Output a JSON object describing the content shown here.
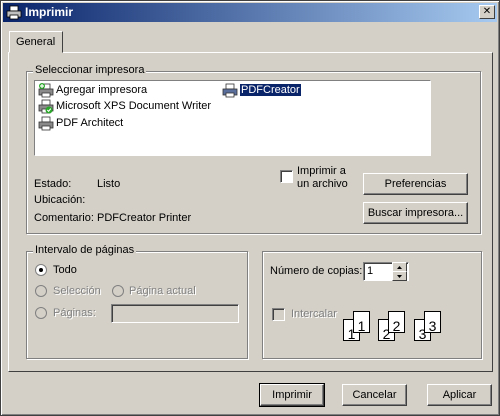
{
  "window": {
    "title": "Imprimir",
    "close_glyph": "✕"
  },
  "tabs": [
    {
      "label": "General",
      "active": true
    }
  ],
  "select_printer": {
    "legend": "Seleccionar impresora",
    "printers": [
      {
        "label": "Agregar impresora",
        "icon": "add-printer-icon",
        "selected": false
      },
      {
        "label": "Microsoft XPS Document Writer",
        "icon": "default-printer-icon",
        "selected": false
      },
      {
        "label": "PDF Architect",
        "icon": "printer-icon",
        "selected": false
      },
      {
        "label": "PDFCreator",
        "icon": "printer-icon",
        "selected": true
      }
    ],
    "status_label": "Estado:",
    "status_value": "Listo",
    "location_label": "Ubicación:",
    "location_value": "",
    "comment_label": "Comentario:",
    "comment_value": "PDFCreator Printer",
    "print_to_file_line1": "Imprimir a",
    "print_to_file_line2": "un archivo",
    "print_to_file_checked": false,
    "preferences_button": "Preferencias",
    "find_printer_button": "Buscar impresora..."
  },
  "page_range": {
    "legend": "Intervalo de páginas",
    "all": "Todo",
    "selection": "Selección",
    "current_page": "Página actual",
    "pages": "Páginas:",
    "selected_option": "all",
    "pages_value": ""
  },
  "copies": {
    "label": "Número de copias:",
    "value": "1",
    "collate_label": "Intercalar",
    "collate_checked": false,
    "collate_enabled": false,
    "collate_digits": [
      "1",
      "1",
      "2",
      "2",
      "3",
      "3"
    ]
  },
  "footer": {
    "print_button": "Imprimir",
    "cancel_button": "Cancelar",
    "apply_button": "Aplicar"
  },
  "colors": {
    "titlebar_start": "#0a246a",
    "titlebar_end": "#a6caf0",
    "face": "#d4d0c8",
    "selection": "#0a246a"
  }
}
